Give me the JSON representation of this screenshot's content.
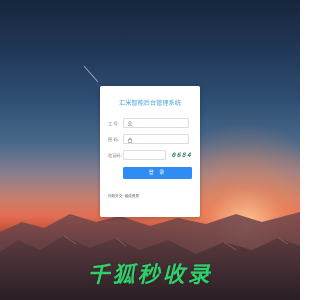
{
  "login_card": {
    "title": "汇米智能后台管理系统",
    "username_label": "工 号:",
    "password_label": "密 码:",
    "captcha_label": "验证码:",
    "captcha_image_text": "0684",
    "submit_label": "登 录",
    "footer_prefix": "仲政务交·",
    "footer_link": "组成资质"
  },
  "watermark": {
    "text": "千狐秒收录"
  },
  "colors": {
    "accent_blue": "#2f8cf2",
    "title_blue": "#4aa3df",
    "watermark_green": "#2fd06a"
  },
  "icons": {
    "username": "user-icon",
    "password": "lock-icon"
  }
}
